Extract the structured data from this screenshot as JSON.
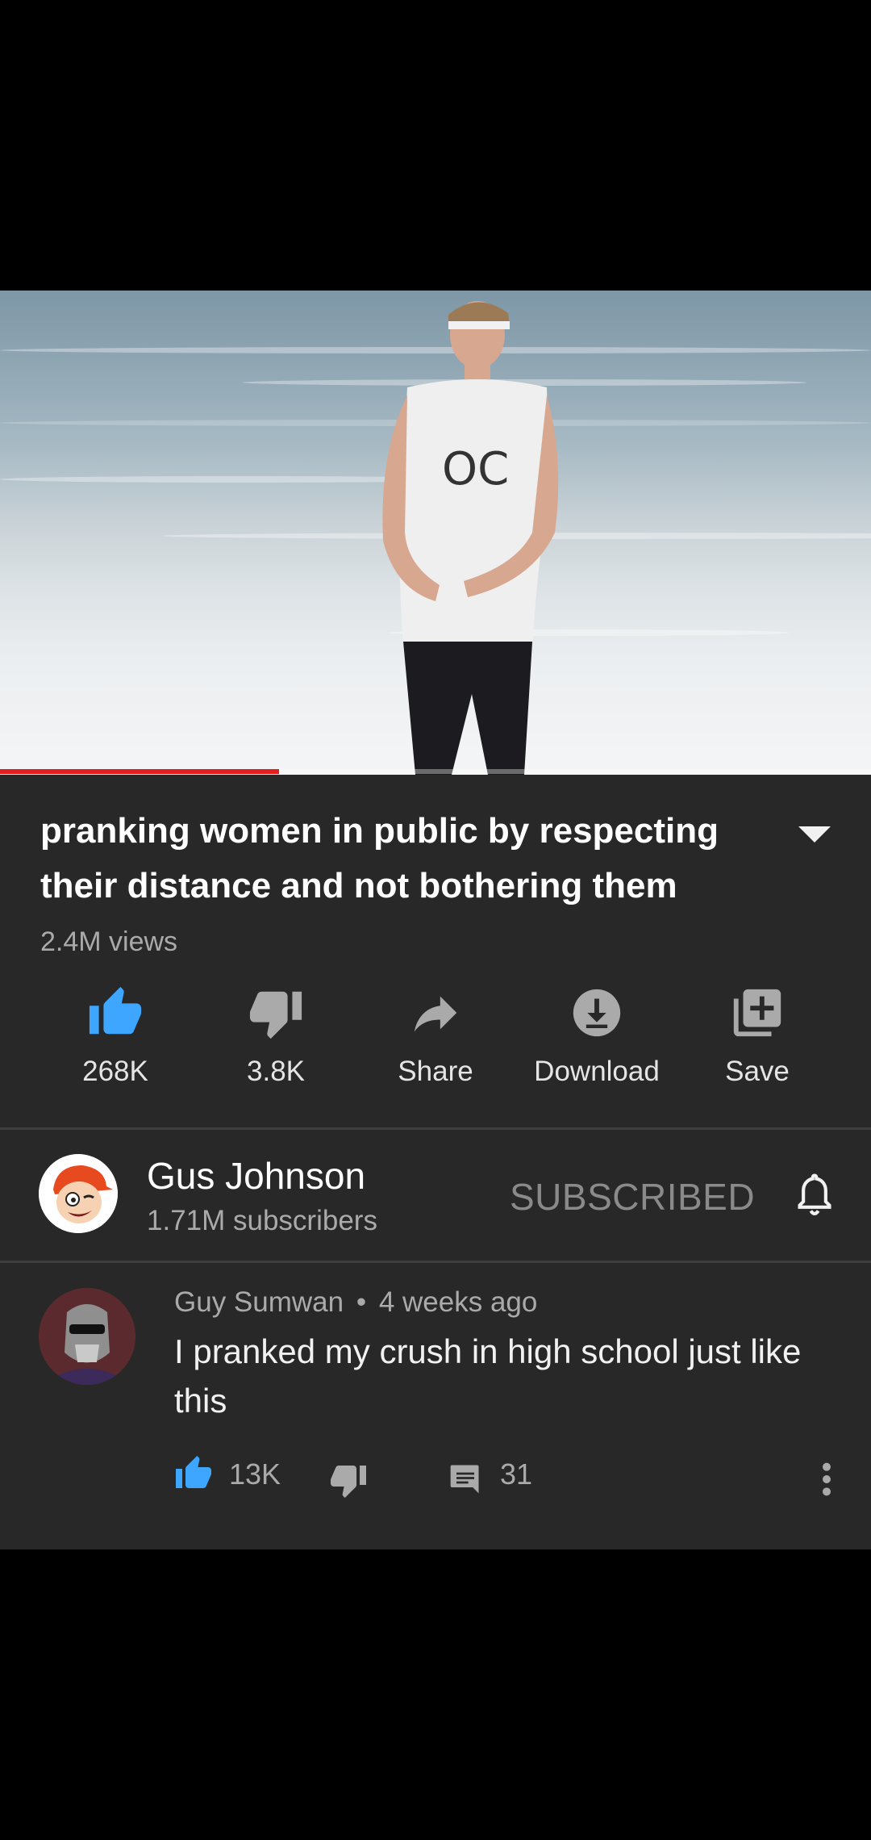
{
  "video": {
    "progress_fraction": 0.32,
    "shirt_text": "OC"
  },
  "title": "pranking women in public by respecting their distance and not bothering them",
  "views": "2.4M views",
  "actions": {
    "like": {
      "label": "268K",
      "icon": "thumb-up-filled-icon",
      "color": "#3ea6ff"
    },
    "dislike": {
      "label": "3.8K",
      "icon": "thumb-down-icon"
    },
    "share": {
      "label": "Share",
      "icon": "share-arrow-icon"
    },
    "download": {
      "label": "Download",
      "icon": "download-icon"
    },
    "save": {
      "label": "Save",
      "icon": "playlist-add-icon"
    }
  },
  "channel": {
    "name": "Gus Johnson",
    "subscribers": "1.71M subscribers",
    "subscribe_state": "SUBSCRIBED"
  },
  "comment": {
    "author": "Guy Sumwan",
    "age": "4 weeks ago",
    "separator": "•",
    "text": "I pranked my crush in high school just like this",
    "likes": "13K",
    "replies": "31"
  },
  "colors": {
    "background": "#000000",
    "panel": "#282828",
    "accent_blue": "#3ea6ff",
    "progress_red": "#e61e1e",
    "secondary_text": "#aaaaaa"
  }
}
